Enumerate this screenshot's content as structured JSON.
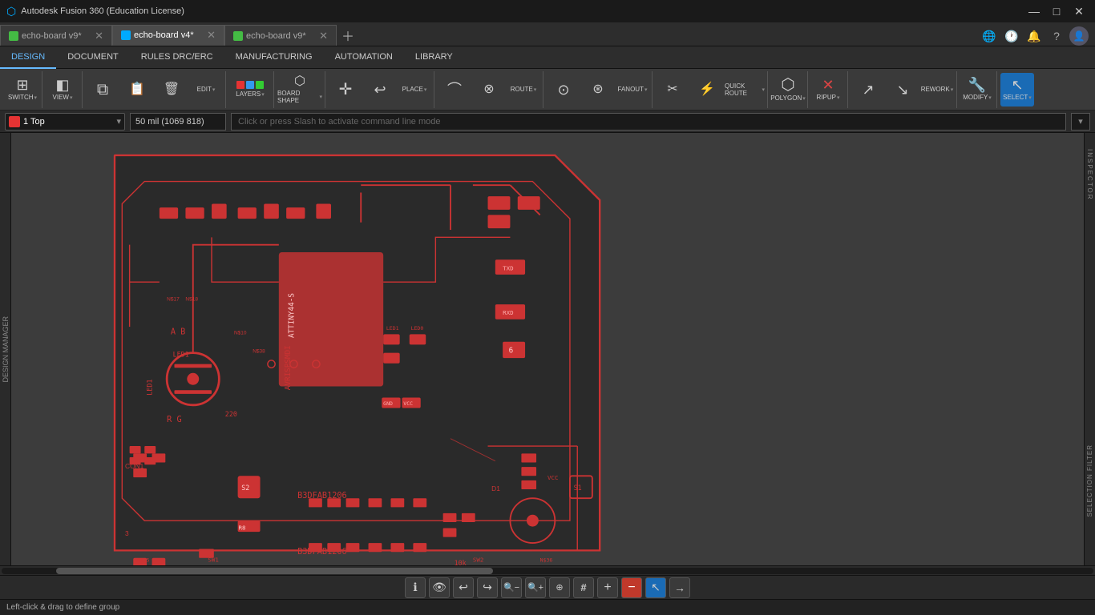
{
  "app": {
    "title": "Autodesk Fusion 360 (Education License)",
    "icon": "🔷"
  },
  "tabs": [
    {
      "id": "tab1",
      "label": "echo-board v9*",
      "icon": "green",
      "active": false,
      "closable": true
    },
    {
      "id": "tab2",
      "label": "echo-board v4*",
      "icon": "blue",
      "active": true,
      "closable": true
    },
    {
      "id": "tab3",
      "label": "echo-board v9*",
      "icon": "green",
      "active": false,
      "closable": true
    }
  ],
  "menu_tabs": [
    {
      "id": "design",
      "label": "DESIGN",
      "active": true
    },
    {
      "id": "document",
      "label": "DOCUMENT",
      "active": false
    },
    {
      "id": "rules",
      "label": "RULES DRC/ERC",
      "active": false
    },
    {
      "id": "manufacturing",
      "label": "MANUFACTURING",
      "active": false
    },
    {
      "id": "automation",
      "label": "AUTOMATION",
      "active": false
    },
    {
      "id": "library",
      "label": "LIBRARY",
      "active": false
    }
  ],
  "toolbar": {
    "groups": [
      {
        "id": "switch",
        "buttons": [
          {
            "id": "switch-btn",
            "icon": "⊞",
            "label": "SWITCH",
            "has_arrow": true
          }
        ]
      },
      {
        "id": "view",
        "buttons": [
          {
            "id": "view-btn",
            "icon": "◫",
            "label": "VIEW",
            "has_arrow": true
          }
        ]
      },
      {
        "id": "edit",
        "buttons": [
          {
            "id": "copy-btn",
            "icon": "⧉",
            "label": ""
          },
          {
            "id": "paste-btn",
            "icon": "📋",
            "label": ""
          },
          {
            "id": "delete-btn",
            "icon": "🗑",
            "label": ""
          },
          {
            "id": "edit-btn",
            "icon": "✏",
            "label": "EDIT",
            "has_arrow": true
          }
        ]
      },
      {
        "id": "layers",
        "buttons": [
          {
            "id": "layers-btn",
            "icon": "⬛",
            "label": "LAYERS",
            "has_arrow": true
          }
        ]
      },
      {
        "id": "board_shape",
        "buttons": [
          {
            "id": "boardshape-btn",
            "icon": "⬡",
            "label": "BOARD SHAPE",
            "has_arrow": true
          }
        ]
      },
      {
        "id": "place",
        "buttons": [
          {
            "id": "move-btn",
            "icon": "✛",
            "label": ""
          },
          {
            "id": "undo-btn",
            "icon": "↩",
            "label": ""
          },
          {
            "id": "place-btn",
            "icon": "📍",
            "label": "PLACE",
            "has_arrow": true
          }
        ]
      },
      {
        "id": "route",
        "buttons": [
          {
            "id": "route-btn1",
            "icon": "⌒",
            "label": ""
          },
          {
            "id": "route-btn2",
            "icon": "⊗",
            "label": ""
          },
          {
            "id": "route-btn",
            "icon": "∿",
            "label": "ROUTE",
            "has_arrow": true
          }
        ]
      },
      {
        "id": "fanout",
        "buttons": [
          {
            "id": "fanout-btn1",
            "icon": "⊙",
            "label": ""
          },
          {
            "id": "fanout-btn",
            "icon": "⊛",
            "label": "FANOUT",
            "has_arrow": true
          }
        ]
      },
      {
        "id": "quickroute",
        "buttons": [
          {
            "id": "qroute-btn1",
            "icon": "✂",
            "label": ""
          },
          {
            "id": "qroute-btn",
            "icon": "⚡",
            "label": "QUICK ROUTE",
            "has_arrow": true
          }
        ]
      },
      {
        "id": "polygon",
        "buttons": [
          {
            "id": "polygon-btn",
            "icon": "⬡",
            "label": "POLYGON",
            "has_arrow": true
          }
        ]
      },
      {
        "id": "ripup",
        "buttons": [
          {
            "id": "ripup-btn",
            "icon": "✕",
            "label": "RIPUP",
            "has_arrow": true
          }
        ]
      },
      {
        "id": "rework",
        "buttons": [
          {
            "id": "rework-btn1",
            "icon": "↗",
            "label": ""
          },
          {
            "id": "rework-btn",
            "icon": "↘",
            "label": "REWORK",
            "has_arrow": true
          }
        ]
      },
      {
        "id": "modify",
        "buttons": [
          {
            "id": "modify-btn",
            "icon": "🔧",
            "label": "MODIFY",
            "has_arrow": true
          }
        ]
      },
      {
        "id": "select",
        "buttons": [
          {
            "id": "select-btn",
            "icon": "↖",
            "label": "SELECT",
            "has_arrow": true,
            "active": true
          }
        ]
      }
    ]
  },
  "layer_row": {
    "layer_color": "#e53333",
    "layer_name": "1 Top",
    "coordinates": "50 mil (1069 818)",
    "command_placeholder": "Click or press Slash to activate command line mode"
  },
  "side_panels": {
    "left": "DESIGN MANAGER",
    "right_top": "INSPECTOR",
    "right_bottom": "SELECTION FILTER"
  },
  "bottom_toolbar": {
    "buttons": [
      {
        "id": "info-btn",
        "icon": "ℹ",
        "label": "info"
      },
      {
        "id": "eye-btn",
        "icon": "👁",
        "label": "eye"
      },
      {
        "id": "undo2-btn",
        "icon": "↩",
        "label": "undo"
      },
      {
        "id": "redo-btn",
        "icon": "↪",
        "label": "redo"
      },
      {
        "id": "zoom-out-btn",
        "icon": "🔍",
        "label": "zoom-out"
      },
      {
        "id": "zoom-in-btn",
        "icon": "🔍",
        "label": "zoom-in"
      },
      {
        "id": "fit-btn",
        "icon": "⊕",
        "label": "fit"
      },
      {
        "id": "grid-btn",
        "icon": "#",
        "label": "grid"
      },
      {
        "id": "plus-btn",
        "icon": "+",
        "label": "plus"
      },
      {
        "id": "minus-btn",
        "icon": "−",
        "label": "minus",
        "active": true,
        "color": "#e53333"
      },
      {
        "id": "select2-btn",
        "icon": "↖",
        "label": "select",
        "active": true,
        "color": "#1a6bb5"
      },
      {
        "id": "arrow-btn",
        "icon": "→",
        "label": "arrow"
      }
    ]
  },
  "status_bar": {
    "text": "Left-click & drag to define group"
  },
  "title_btns": {
    "minimize": "—",
    "maximize": "□",
    "close": "✕"
  }
}
